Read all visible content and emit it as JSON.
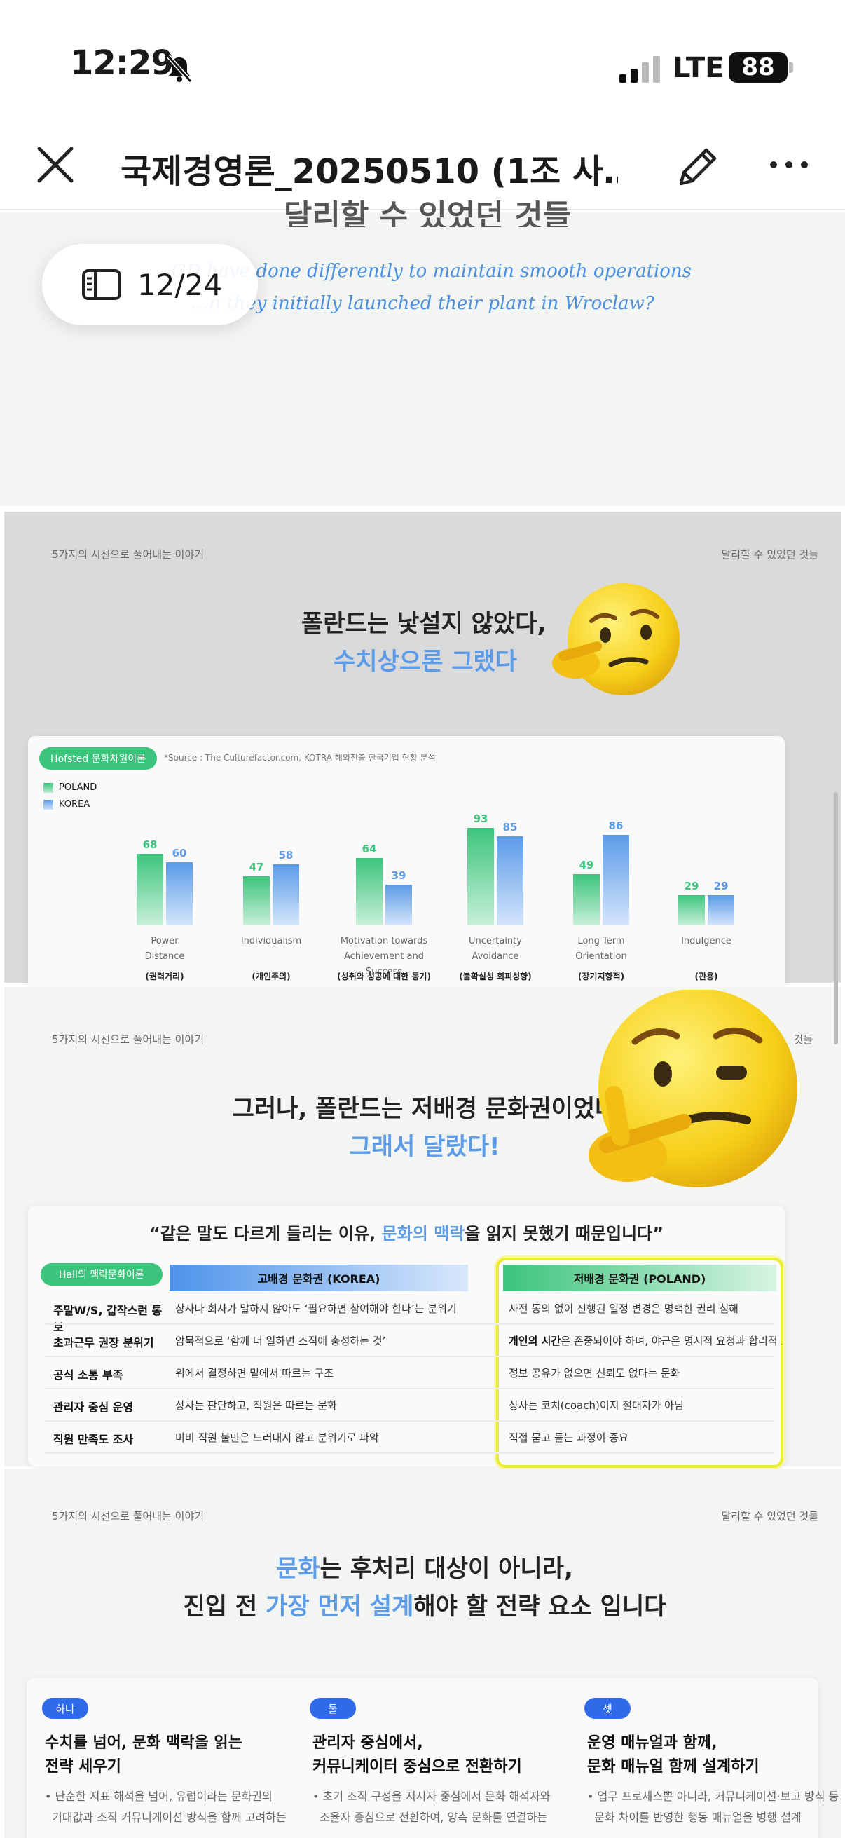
{
  "status_bar": {
    "time": "12:29",
    "network": "LTE",
    "battery": "88"
  },
  "header": {
    "title": "국제경영론_20250510 (1조 사…"
  },
  "page_indicator": {
    "label": "12/24"
  },
  "slide1": {
    "title_fragment": "달리할 수 있었던 것들",
    "line1": "…GD have done differently to maintain smooth operations",
    "line2": "…n they initially launched their plant in Wroclaw?"
  },
  "slide2": {
    "top_left": "5가지의 시선으로 풀어내는 이야기",
    "top_right": "달리할 수 있었던 것들",
    "headline1": "폴란드는 낯설지 않았다,",
    "headline2": "수치상으론 그랬다",
    "badge": "Hofsted 문화차원이론",
    "source": "*Source : The Culturefactor.com, KOTRA 해외진출 한국기업 현황 분석"
  },
  "chart_data": {
    "type": "bar",
    "categories": [
      "Power Distance",
      "Individualism",
      "Motivation towards Achievement and Success",
      "Uncertainty Avoidance",
      "Long Term Orientation",
      "Indulgence"
    ],
    "category_lines": [
      [
        "Power",
        "Distance"
      ],
      [
        "Individualism"
      ],
      [
        "Motivation towards",
        "Achievement and Success"
      ],
      [
        "Uncertainty",
        "Avoidance"
      ],
      [
        "Long Term",
        "Orientation"
      ],
      [
        "Indulgence"
      ]
    ],
    "category_kr": [
      "(권력거리)",
      "(개인주의)",
      "(성취와 성공에 대한 동기)",
      "(불확실성 회피성향)",
      "(장기지향적)",
      "(관용)"
    ],
    "series": [
      {
        "name": "POLAND",
        "values": [
          68,
          47,
          64,
          93,
          49,
          29
        ],
        "color": "#3cc47c"
      },
      {
        "name": "KOREA",
        "values": [
          60,
          58,
          39,
          85,
          86,
          29
        ],
        "color": "#5b9be8"
      }
    ],
    "legend_position": "top-left",
    "grid": false
  },
  "slide3": {
    "top_left": "5가지의 시선으로 풀어내는 이야기",
    "top_right": "것들",
    "headline1": "그러나, 폴란드는 저배경 문화권이었다",
    "headline2": "그래서 달랐다!",
    "quote_pre": "“같은 말도 다르게 들리는 이유, ",
    "quote_hl": "문화의 맥락",
    "quote_post": "을 읽지 못했기 때문입니다”",
    "badge": "Hall의 맥락문화이론",
    "col_korea": "고배경 문화권 (KOREA)",
    "col_poland": "저배경 문화권 (POLAND)",
    "rows": [
      {
        "label": "주말W/S, 갑작스런 통보",
        "korea": "상사나 회사가 말하지 않아도 ‘필요하면 참여해야 한다’는 분위기",
        "poland": "사전 동의 없이 진행된 일정 변경은 명백한 권리 침해"
      },
      {
        "label": "초과근무 권장 분위기",
        "korea": "암묵적으로 ‘함께 더 일하면 조직에 충성하는 것’",
        "poland_bold": "개인의 시간",
        "poland": "은 존중되어야 하며, 야근은 명시적 요청과 합리적 보상이 전제"
      },
      {
        "label": "공식 소통 부족",
        "korea": "위에서 결정하면 밑에서 따르는 구조",
        "poland": "정보 공유가 없으면 신뢰도 없다는 문화"
      },
      {
        "label": "관리자 중심 운영",
        "korea": "상사는 판단하고, 직원은 따르는 문화",
        "poland": "상사는 코치(coach)이지 절대자가 아님"
      },
      {
        "label": "직원 만족도 조사",
        "korea": "미비 직원 불만은 드러내지 않고 분위기로 파악",
        "poland": "직접 묻고 듣는 과정이 중요"
      }
    ]
  },
  "slide4": {
    "top_left": "5가지의 시선으로 풀어내는 이야기",
    "top_right": "달리할 수 있었던 것들",
    "headline1_hl": "문화",
    "headline1": "는 후처리 대상이 아니라,",
    "headline2_pre": "진입 전 ",
    "headline2_hl": "가장 먼저 설계",
    "headline2_post": "해야 할 전략 요소 입니다",
    "columns": [
      {
        "num": "하나",
        "title1": "수치를 넘어, 문화 맥락을 읽는",
        "title2": "전략 세우기",
        "body1": "• 단순한 지표 해석을 넘어, 유럽이라는 문화권의",
        "body2": "  기대값과 조직 커뮤니케이션 방식을 함께 고려하는"
      },
      {
        "num": "둘",
        "title1": "관리자 중심에서,",
        "title2": "커뮤니케이터 중심으로 전환하기",
        "body1": "• 초기 조직 구성을 지시자 중심에서 문화 해석자와",
        "body2": "  조율자 중심으로 전환하여, 양측 문화를 연결하는"
      },
      {
        "num": "셋",
        "title1": "운영 매뉴얼과 함께,",
        "title2": "문화 매뉴얼 함께 설계하기",
        "body1": "• 업무 프로세스뿐 아니라, 커뮤니케이션·보고 방식 등",
        "body2": "  문화 차이를 반영한 행동 매뉴얼을 병행 설계"
      }
    ]
  }
}
